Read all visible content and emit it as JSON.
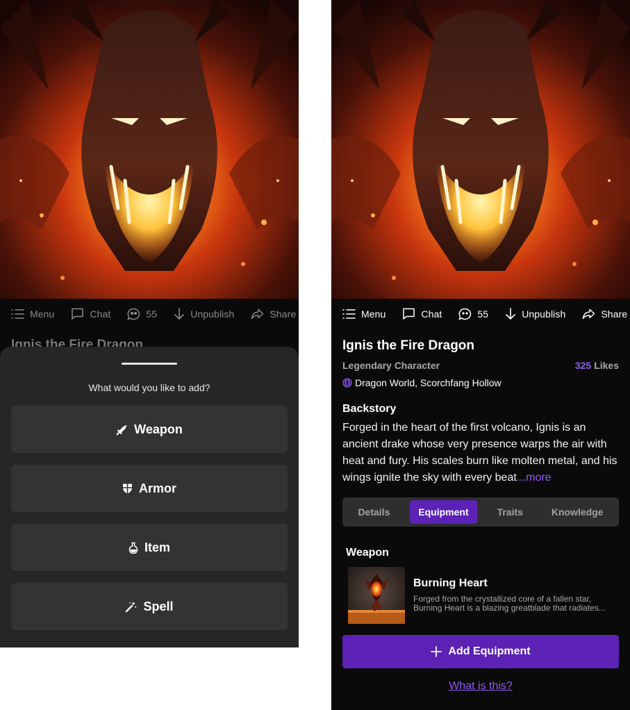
{
  "actions": {
    "menu": "Menu",
    "chat": "Chat",
    "comments": "55",
    "unpublish": "Unpublish",
    "share": "Share"
  },
  "sheet": {
    "prompt": "What would you like to add?",
    "options": [
      {
        "label": "Weapon",
        "icon": "sword-icon"
      },
      {
        "label": "Armor",
        "icon": "shield-icon"
      },
      {
        "label": "Item",
        "icon": "potion-icon"
      },
      {
        "label": "Spell",
        "icon": "magic-wand-icon"
      }
    ]
  },
  "character": {
    "name": "Ignis the Fire Dragon",
    "category": "Legendary Character",
    "likes_count": "325",
    "likes_label": "Likes",
    "location": "Dragon World, Scorchfang Hollow"
  },
  "backstory": {
    "heading": "Backstory",
    "text": "Forged in the heart of the first volcano, Ignis is an ancient drake whose very presence warps the air with heat and fury. His scales burn like molten metal, and his wings ignite the sky with every beat",
    "more_label": "...more"
  },
  "tabs": [
    {
      "label": "Details",
      "active": false
    },
    {
      "label": "Equipment",
      "active": true
    },
    {
      "label": "Traits",
      "active": false
    },
    {
      "label": "Knowledge",
      "active": false
    }
  ],
  "equipment": {
    "heading": "Weapon",
    "item_name": "Burning Heart",
    "item_desc_line1": "Forged from the crystallized core of a fallen star,",
    "item_desc_line2": "Burning Heart is a blazing greatblade that radiates..."
  },
  "add_button": "Add Equipment",
  "help_link": "What is this?",
  "colors": {
    "accent": "#5b22b5",
    "link": "#8e5cf0",
    "background": "#0a0a0a",
    "sheet": "#262626",
    "option": "#333333"
  }
}
